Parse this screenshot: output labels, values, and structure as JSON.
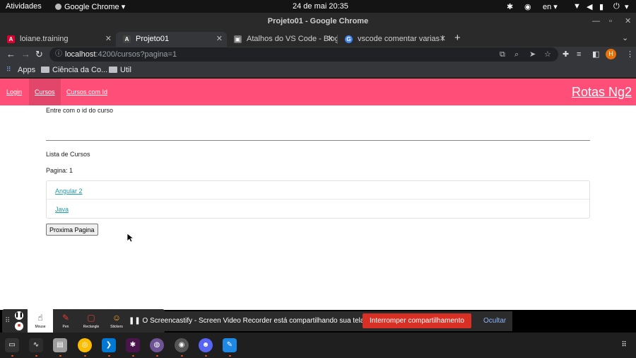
{
  "os": {
    "activities": "Atividades",
    "app_menu": "Google Chrome",
    "datetime": "24 de mai  20:35",
    "lang": "en"
  },
  "window": {
    "title": "Projeto01 - Google Chrome"
  },
  "tabs": [
    {
      "label": "loiane.training",
      "color": "#dd0031"
    },
    {
      "label": "Projeto01",
      "color": "#dd0031"
    },
    {
      "label": "Atalhos do VS Code - Blog",
      "color": "#555555"
    },
    {
      "label": "vscode comentar varias l",
      "color": "#4285f4"
    }
  ],
  "address": {
    "host": "localhost",
    "path": ":4200/cursos?pagina=1"
  },
  "profile": {
    "initial": "H"
  },
  "bookmarks": [
    {
      "label": "Apps"
    },
    {
      "label": "Ciência da Co..."
    },
    {
      "label": "Util"
    }
  ],
  "app": {
    "nav": [
      {
        "label": "Login"
      },
      {
        "label": "Cursos"
      },
      {
        "label": "Cursos com Id"
      }
    ],
    "brand": "Rotas Ng2",
    "id_label": "Entre com o id do curso",
    "id_value": "",
    "list_title": "Lista de Cursos",
    "page_label": "Pagina: 1",
    "courses": [
      {
        "name": "Angular 2"
      },
      {
        "name": "Java"
      }
    ],
    "next_button": "Proxima Pagina"
  },
  "screencastify": {
    "tools": [
      {
        "label": "Mouse"
      },
      {
        "label": "Pen"
      },
      {
        "label": "Rectangle"
      },
      {
        "label": "Stickers"
      }
    ],
    "message": "O Screencastify - Screen Video Recorder está compartilhando sua tela.",
    "stop_label": "Interromper compartilhamento",
    "hide_label": "Ocultar"
  },
  "colors": {
    "nav_bg": "#ff4f78",
    "link": "#1a9aa7",
    "stop": "#d93025"
  }
}
